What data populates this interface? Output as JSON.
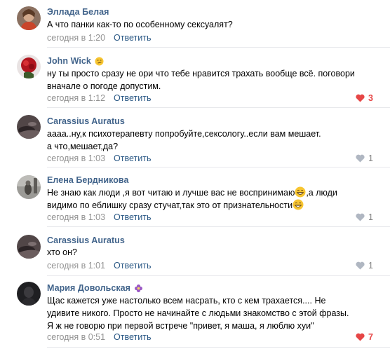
{
  "comments": [
    {
      "author": "Эллада Белая",
      "badge": null,
      "lines": [
        "А что панки как-то по особенному сексуалят?"
      ],
      "date": "сегодня в 1:20",
      "reply_label": "Ответить",
      "likes": null,
      "liked": false
    },
    {
      "author": "John Wick",
      "badge": "emoji-smirk-icon",
      "lines": [
        "ну ты просто сразу не ори что тебе нравится трахать вообще всё. поговори",
        "вначале о погоде допустим."
      ],
      "date": "сегодня в 1:12",
      "reply_label": "Ответить",
      "likes": "3",
      "liked": true
    },
    {
      "author": "Carassius Auratus",
      "badge": null,
      "lines": [
        "аааа..ну,к психотерапевту попробуйте,сексологу..если вам мешает.",
        "а что,мешает,да?"
      ],
      "date": "сегодня в 1:03",
      "reply_label": "Ответить",
      "likes": "1",
      "liked": false
    },
    {
      "author": "Елена Бердникова",
      "badge": null,
      "lines": [
        "Не знаю как люди ,я вот читаю и лучше вас не воспринимаю",
        "видимо по еблишку сразу стучат,так это от признательности"
      ],
      "line_suffix_1a": ",а люди",
      "date": "сегодня в 1:03",
      "reply_label": "Ответить",
      "likes": "1",
      "liked": false
    },
    {
      "author": "Carassius Auratus",
      "badge": null,
      "lines": [
        "хто он?"
      ],
      "date": "сегодня в 1:01",
      "reply_label": "Ответить",
      "likes": "1",
      "liked": false
    },
    {
      "author": "Мария Довольская",
      "badge": "purple-flower-icon",
      "lines": [
        "Щас кажется уже настолько всем насрать, кто с кем трахается.... Не",
        "удивите никого. Просто не начинайте с людьми знакомство с этой фразы.",
        "Я ж не говорю при первой встрече \"привет, я маша, я люблю хуи\""
      ],
      "date": "сегодня в 0:51",
      "reply_label": "Ответить",
      "likes": "7",
      "liked": true
    }
  ],
  "colors": {
    "author": "#42648b",
    "reply": "#2a5885",
    "date": "#939393",
    "liked": "#e64646",
    "not_liked": "#828282",
    "divider": "#e7e8ec"
  }
}
